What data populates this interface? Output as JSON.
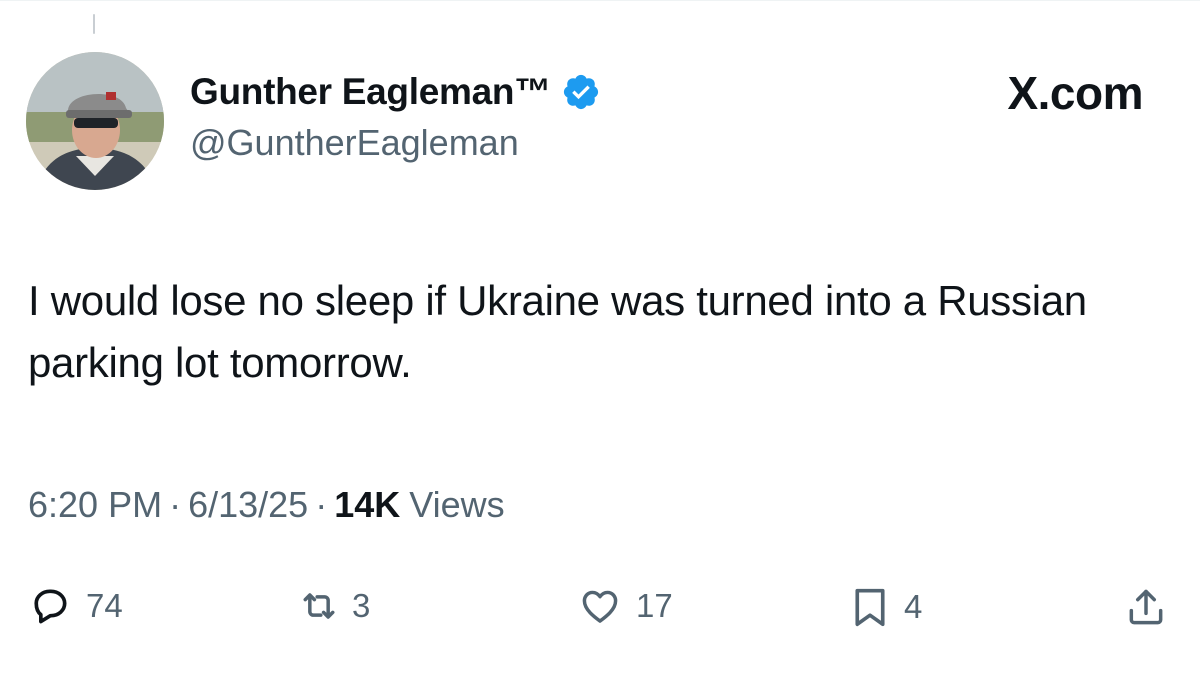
{
  "author": {
    "display_name": "Gunther Eagleman™",
    "handle": "@GuntherEagleman",
    "verified": true,
    "avatar_icon": "profile-photo"
  },
  "brand": {
    "label": "X.com"
  },
  "tweet": {
    "text": "I would lose no sleep if Ukraine was turned into a Russian parking lot tomorrow."
  },
  "meta": {
    "time": "6:20 PM",
    "separator": "·",
    "date": "6/13/25",
    "views_count": "14K",
    "views_label": "Views"
  },
  "actions": {
    "replies": {
      "icon": "reply-icon",
      "count": "74"
    },
    "reposts": {
      "icon": "repost-icon",
      "count": "3"
    },
    "likes": {
      "icon": "heart-icon",
      "count": "17"
    },
    "bookmarks": {
      "icon": "bookmark-icon",
      "count": "4"
    },
    "share": {
      "icon": "share-icon"
    }
  },
  "colors": {
    "text_primary": "#0f1419",
    "text_secondary": "#536471",
    "verified_blue": "#1d9bf0"
  }
}
